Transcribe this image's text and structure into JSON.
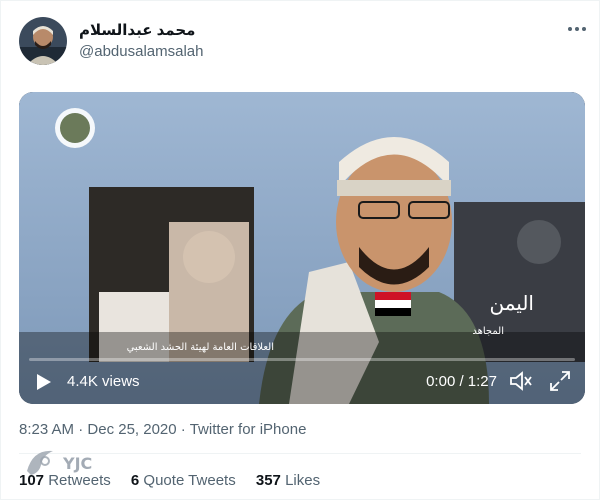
{
  "author": {
    "display_name": "محمد عبدالسلام",
    "handle": "@abdusalamsalah"
  },
  "video": {
    "views": "4.4K views",
    "time": "0:00 / 1:27",
    "overlay_country": "اليمن",
    "overlay_caption_left": "العلاقات العامة لهيئة الحشد الشعبي",
    "overlay_caption_right": "المجاهد"
  },
  "meta": {
    "time": "8:23 AM",
    "date": "Dec 25, 2020",
    "source": "Twitter for iPhone",
    "sep": "·"
  },
  "stats": {
    "retweets_count": "107",
    "retweets_label": "Retweets",
    "quotes_count": "6",
    "quotes_label": "Quote Tweets",
    "likes_count": "357",
    "likes_label": "Likes"
  },
  "watermark": {
    "text": "YJC"
  },
  "icons": {
    "more": "more-horizontal-icon",
    "play": "play-icon",
    "volume": "volume-icon",
    "fullscreen": "fullscreen-icon"
  },
  "colors": {
    "text_primary": "#0f1419",
    "text_secondary": "#536471",
    "divider": "#eff3f4",
    "video_bg": "#0b0f14"
  }
}
